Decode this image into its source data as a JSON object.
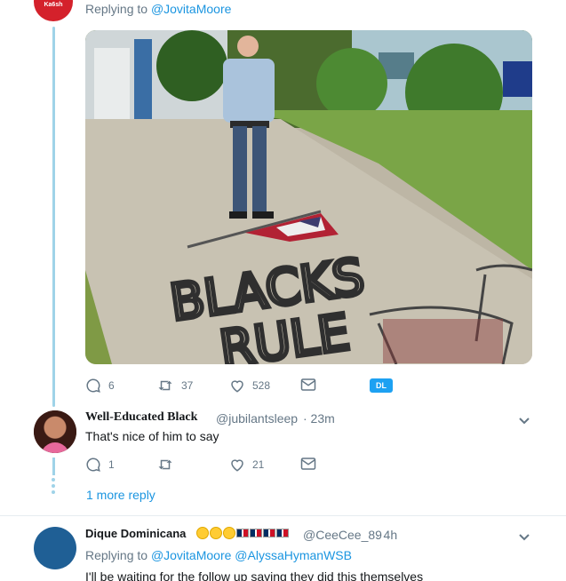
{
  "top_tweet": {
    "avatar_label": "Ka6sh",
    "replying_prefix": "Replying to",
    "replying_handle": "@JovitaMoore",
    "actions": {
      "reply_count": "6",
      "retweet_count": "37",
      "like_count": "528",
      "badge": "DL"
    }
  },
  "reply_1": {
    "name": "Well-Educated Black",
    "handle": "@jubilantsleep",
    "time": "· 23m",
    "text": "That's nice of him to say",
    "actions": {
      "reply_count": "1",
      "retweet_count": "",
      "like_count": "21"
    }
  },
  "more_reply": "1 more reply",
  "reply_2": {
    "name": "Dique Dominicana",
    "handle": "@CeeCee_89",
    "time": "· 4h",
    "replying_prefix": "Replying to",
    "replying_handles": "@JovitaMoore @AlyssaHymanWSB",
    "text": "I'll be waiting for the follow up saying they did this themselves"
  },
  "photo": {
    "graffiti_line1": "BLACKS",
    "graffiti_line2": "RULE"
  },
  "colors": {
    "link": "#1b95e0",
    "thread_line": "#9fd3e8",
    "muted": "#657786"
  }
}
